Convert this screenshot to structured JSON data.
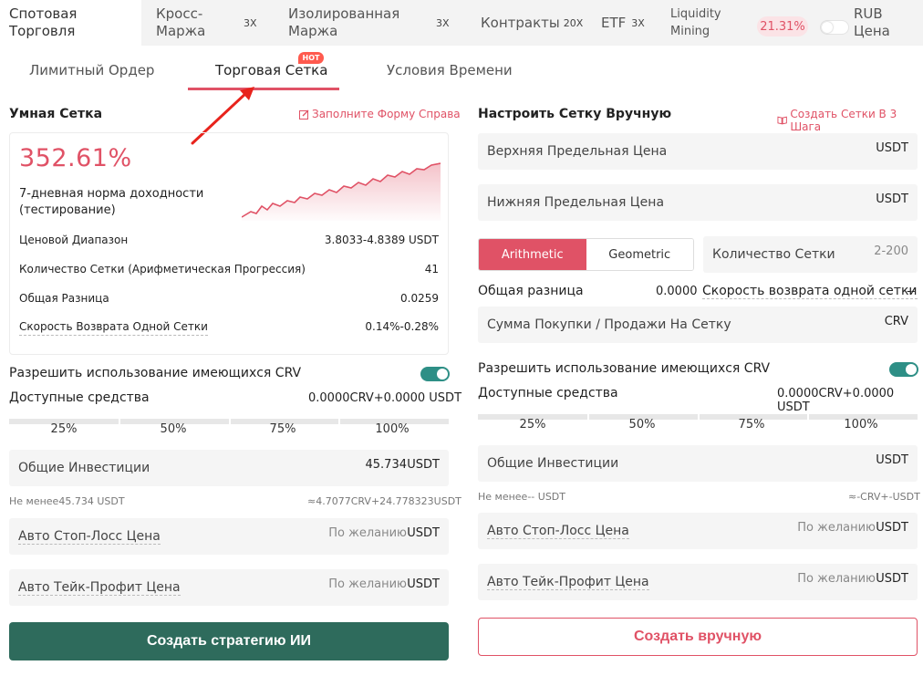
{
  "topnav": {
    "spot": "Спотовая Торговля",
    "cross": "Кросс-Маржа",
    "cross_lev": "3X",
    "isolated": "Изолированная Маржа",
    "isolated_lev": "3X",
    "contracts": "Контракты",
    "contracts_lev": "20X",
    "etf": "ETF",
    "etf_lev": "3X",
    "liquidity": "Liquidity Mining",
    "liquidity_pct": "21.31%",
    "rub": "RUB Цена"
  },
  "subtabs": {
    "limit": "Лимитный Ордер",
    "grid": "Торговая Сетка",
    "hot": "HOT",
    "time": "Условия Времени"
  },
  "smart": {
    "title": "Умная Сетка",
    "fill_link": "Заполните Форму Справа",
    "pct": "352.61%",
    "yield_label": "7-дневная норма доходности (тестирование)",
    "rows": [
      {
        "label": "Ценовой Диапазон",
        "value": "3.8033-4.8389 USDT"
      },
      {
        "label": "Количество Сетки (Арифметическая Прогрессия)",
        "value": "41"
      },
      {
        "label": "Общая Разница",
        "value": "0.0259"
      },
      {
        "label": "Скорость Возврата Одной Сетки",
        "value": "0.14%-0.28%"
      }
    ],
    "allow": "Разрешить использование имеющихся CRV",
    "avail_label": "Доступные средства",
    "avail_value": "0.0000CRV+0.0000 USDT",
    "slider": [
      "25%",
      "50%",
      "75%",
      "100%"
    ],
    "invest_label": "Общие Инвестиции",
    "invest_value": "45.734",
    "invest_unit": "USDT",
    "min_note": "Не менее45.734 USDT",
    "approx_note": "≈4.7077CRV+24.778323USDT",
    "stoploss_label": "Авто Стоп-Лосс Цена",
    "takeprofit_label": "Авто Тейк-Профит Цена",
    "optional": "По желанию",
    "unit": "USDT",
    "button": "Создать стратегию ИИ"
  },
  "manual": {
    "title": "Настроить Сетку Вручную",
    "steps_link": "Создать Сетки В 3 Шага",
    "upper_label": "Верхняя Предельная Цена",
    "lower_label": "Нижняя Предельная Цена",
    "unit": "USDT",
    "arith": "Arithmetic",
    "geom": "Geometric",
    "count_label": "Количество Сетки",
    "count_placeholder": "2-200",
    "diff_label": "Общая разница",
    "diff_value": "0.0000",
    "rate_label": "Скорость возврата одной сетки",
    "rate_value": "--",
    "buy_label": "Сумма Покупки / Продажи На Сетку",
    "buy_unit": "CRV",
    "allow": "Разрешить использование имеющихся CRV",
    "avail_label": "Доступные средства",
    "avail_value": "0.0000CRV+0.0000 USDT",
    "slider": [
      "25%",
      "50%",
      "75%",
      "100%"
    ],
    "invest_label": "Общие Инвестиции",
    "min_note": "Не менее-- USDT",
    "approx_note": "≈-CRV+-USDT",
    "stoploss_label": "Авто Стоп-Лосс Цена",
    "takeprofit_label": "Авто Тейк-Профит Цена",
    "optional": "По желанию",
    "button": "Создать вручную"
  },
  "colors": {
    "accent": "#e05266",
    "primary_button": "#2e6b5c",
    "toggle_on": "#2e8f86"
  }
}
